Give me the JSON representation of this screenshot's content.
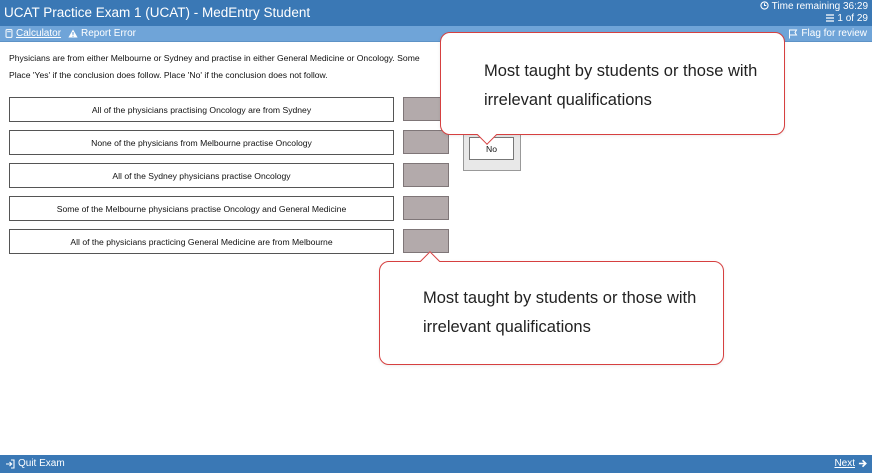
{
  "header": {
    "title": "UCAT Practice Exam 1 (UCAT) - MedEntry Student",
    "time_remaining": "Time remaining 36:29",
    "progress": "1 of 29"
  },
  "toolbar": {
    "calculator": "Calculator",
    "report_error": "Report Error",
    "flag": "Flag for review"
  },
  "question": {
    "intro": "Physicians are from either Melbourne or Sydney and practise in either General Medicine or Oncology. Some",
    "instruction": "Place 'Yes' if the conclusion does follow. Place 'No' if the conclusion does not follow.",
    "statements": [
      "All of the physicians practising Oncology are from Sydney",
      "None of the physicians from Melbourne practise Oncology",
      "All of the Sydney physicians practise Oncology",
      "Some of the Melbourne physicians practise Oncology and General Medicine",
      "All of the physicians practicing General Medicine are from Melbourne"
    ],
    "option_no": "No"
  },
  "callouts": {
    "top": "Most taught by students or those with irrelevant qualifications",
    "bottom": "Most taught by students or those with irrelevant qualifications"
  },
  "footer": {
    "quit": "Quit Exam",
    "next": "Next"
  }
}
